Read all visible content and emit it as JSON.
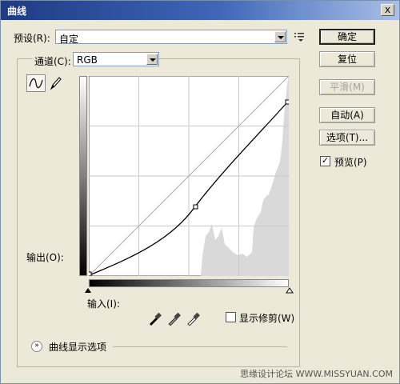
{
  "window": {
    "title": "曲线",
    "close": "x"
  },
  "preset": {
    "label": "预设(R):",
    "value": "自定"
  },
  "channel": {
    "label": "通道(C):",
    "value": "RGB"
  },
  "buttons": {
    "ok": "确定",
    "reset": "复位",
    "smooth": "平滑(M)",
    "auto": "自动(A)",
    "options": "选项(T)..."
  },
  "preview": {
    "label": "预览(P)",
    "checked": true
  },
  "graph": {
    "output_label": "输出(O):",
    "input_label": "输入(I):"
  },
  "clipping": {
    "label": "显示修剪(W)",
    "checked": false
  },
  "curve_options": {
    "label": "曲线显示选项"
  },
  "watermark": "思缘设计论坛  WWW.MISSYUAN.COM"
}
